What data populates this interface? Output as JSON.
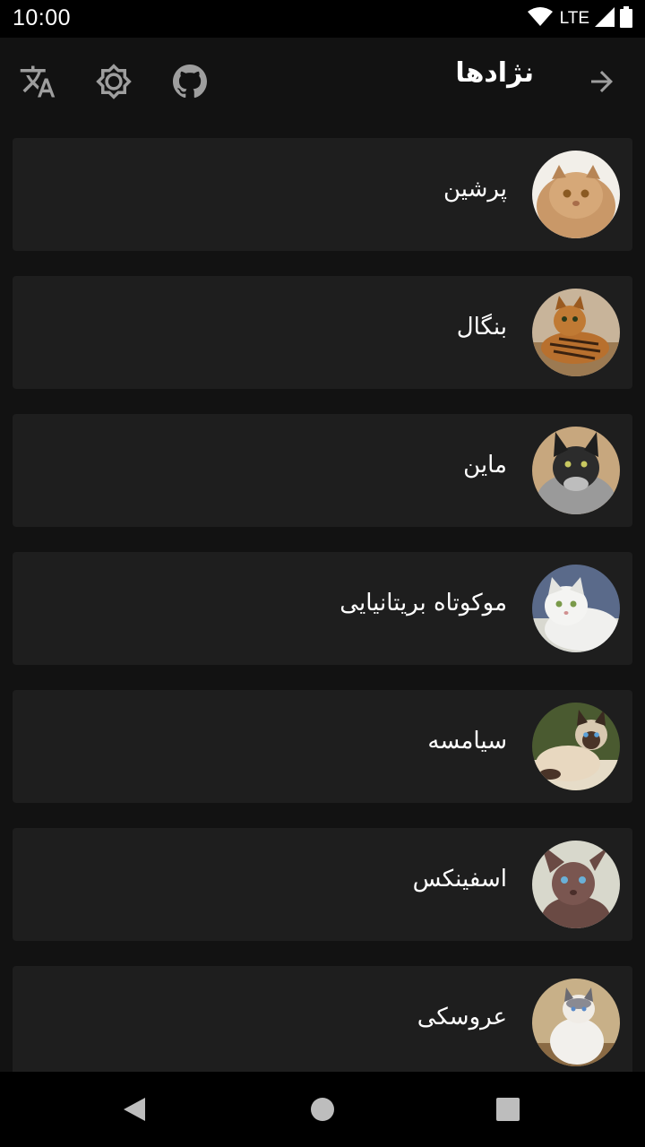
{
  "status_bar": {
    "time": "10:00",
    "network": "LTE",
    "icons": [
      "wifi-icon",
      "signal-icon",
      "battery-icon"
    ]
  },
  "app_bar": {
    "title": "نژادها",
    "actions": [
      "translate-icon",
      "brightness-icon",
      "github-icon"
    ],
    "back_icon": "arrow-forward-icon"
  },
  "breeds": [
    {
      "name": "پرشین"
    },
    {
      "name": "بنگال"
    },
    {
      "name": "ماین"
    },
    {
      "name": "موکوتاه بریتانیایی"
    },
    {
      "name": "سیامسه"
    },
    {
      "name": "اسفینکس"
    },
    {
      "name": "عروسکی"
    }
  ],
  "nav_bar": {
    "icons": [
      "back-triangle-icon",
      "home-circle-icon",
      "recents-square-icon"
    ]
  },
  "colors": {
    "background": "#121212",
    "card": "#1e1e1e",
    "text": "#ffffff",
    "icon": "#9e9e9e"
  }
}
